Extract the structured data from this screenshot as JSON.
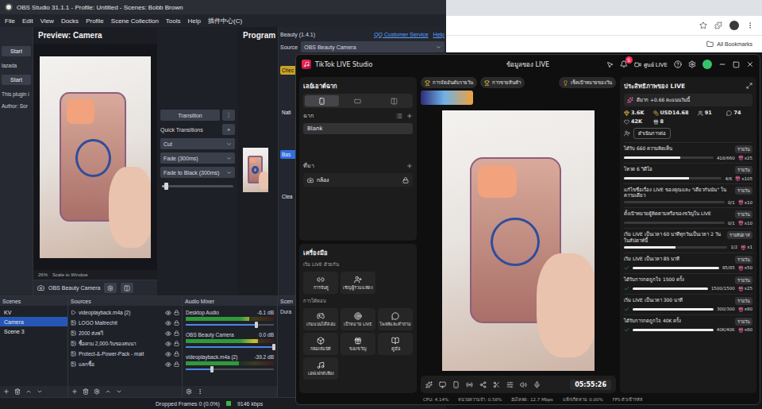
{
  "obs": {
    "title": "OBS Studio 31.1.1 - Profile: Untitled - Scenes: Bobb Brown",
    "menu": [
      "File",
      "Edit",
      "View",
      "Docks",
      "Profile",
      "Scene Collection",
      "Tools",
      "Help",
      "插件中心(C)"
    ],
    "left_dock": [
      {
        "kind": "button",
        "label": "Start"
      },
      {
        "kind": "label",
        "label": "lazada"
      },
      {
        "kind": "button",
        "label": "Start"
      },
      {
        "kind": "label",
        "label": "This plugin i"
      },
      {
        "kind": "label",
        "label": "Author: Sor"
      }
    ],
    "preview": {
      "title": "Preview: Camera",
      "zoom": "26%",
      "scale": "Scale to Window"
    },
    "program": {
      "title": "Program"
    },
    "transitions": {
      "button": "Transition",
      "menu": "⋮",
      "quick": "Quick Transitions",
      "add": "+",
      "options": [
        "Cut",
        "Fade (300ms)",
        "Fade to Black (300ms)"
      ],
      "level": 0.05
    },
    "source_bar": {
      "name": "OBS Beauty Camera"
    },
    "beauty": {
      "title": "Beauty (1.4.1)",
      "links": [
        "QQ Customer Service",
        "Help"
      ],
      "source_label": "Source",
      "source_value": "OBS Beauty Camera",
      "cut_items": [
        {
          "label": "Chec",
          "kind": "highlight"
        },
        {
          "label": "Nati",
          "kind": "label"
        },
        {
          "label": "Bas",
          "kind": "button"
        },
        {
          "label": "Clea",
          "kind": "label"
        }
      ]
    },
    "scenes": {
      "title": "Scenes",
      "items": [
        {
          "label": "KV",
          "selected": false
        },
        {
          "label": "Camera",
          "selected": true
        },
        {
          "label": "Scene 3",
          "selected": false
        }
      ]
    },
    "sources": {
      "title": "Sources",
      "items": [
        {
          "label": "videoplayback.m4a (2)",
          "kind": "audio",
          "visible": true
        },
        {
          "label": "LOGO Maitrechit",
          "kind": "image",
          "visible": true
        },
        {
          "label": "2000 ส่งฟรี",
          "kind": "image",
          "visible": true
        },
        {
          "label": "ซื้อครบ 2,000-รับของสมนา",
          "kind": "image",
          "visible": true
        },
        {
          "label": "Protect-&-Power-Pack - mait",
          "kind": "image",
          "visible": true
        },
        {
          "label": "แลกซื้อ",
          "kind": "image",
          "visible": true
        }
      ]
    },
    "mixer": {
      "title": "Audio Mixer",
      "channels": [
        {
          "name": "Desktop Audio",
          "reading": "-6.1 dB",
          "level": 0.72,
          "volume": 0.8
        },
        {
          "name": "OBS Beauty Camera",
          "reading": "0.0 dB",
          "level": 0.82,
          "volume": 1
        },
        {
          "name": "videoplayback.m4a (2)",
          "reading": "-39.2 dB",
          "level": 0.6,
          "volume": 0.3
        }
      ]
    },
    "transition_dock": {
      "title": "Scen",
      "label": "Dura"
    },
    "status": {
      "dropped": "Dropped Frames 0 (0.0%)",
      "bitrate": "9146 kbps"
    }
  },
  "browser": {
    "bookmarks": "All Bookmarks"
  },
  "tiktok": {
    "title": "TikTok LIVE Studio",
    "center_title": "ข้อมูลของ LIVE",
    "live_center": "ศูนย์ LIVE",
    "notifications": "5",
    "scene_panel": {
      "title": "เลย์เอาต์ฉาก",
      "orientations": [
        {
          "kind": "portrait",
          "selected": true
        },
        {
          "kind": "landscape",
          "selected": false
        },
        {
          "kind": "multi",
          "selected": false
        }
      ],
      "scenes_label": "ฉาก",
      "scenes": [
        {
          "label": "Blank",
          "selected": true
        }
      ],
      "sources_label": "ที่มา",
      "sources": [
        {
          "label": "กล้อง",
          "locked": true
        }
      ]
    },
    "tools": {
      "title": "เครื่องมือ",
      "groups": [
        {
          "title": "เริ่ม LIVE ด้วยกัน",
          "items": [
            "การจับคู่",
            "เชิญผู้ร่วมแสดง"
          ]
        },
        {
          "title": "การโต้ตอบ",
          "items": [
            "เกมแบบโต้ตอบ",
            "เป้าหมาย LIVE",
            "โพลล์และคำถาม",
            "กล่องสมบัติ",
            "ของขวัญ",
            "คู่มือ",
            "เอฟเฟกต์เสียง"
          ]
        }
      ]
    },
    "top_chips": [
      "การจัดอันดับรายวัน",
      "การขายสินค้า"
    ],
    "goal_chip": "เช็คเป้าหมายของวัน",
    "timer": "05:55:26",
    "status": [
      "CPU: 4.14%",
      "หน่วยความจำ: 0.58%",
      "อัปโหลด: 12.7 Mbps",
      "แพ็กเก็ตหาย: 0.00%",
      "FPS ตัวเข้ารหัส"
    ],
    "performance": {
      "title": "ประสิทธิภาพของ LIVE",
      "score": "ดีมาก +0.66 คะแนนวันนี้",
      "stats": [
        {
          "kind": "diamond",
          "value": "3.6K"
        },
        {
          "kind": "coins",
          "value": "USD14.68"
        },
        {
          "kind": "viewers",
          "value": "91"
        },
        {
          "kind": "comments",
          "value": "74"
        },
        {
          "kind": "likes",
          "value": "42K"
        },
        {
          "kind": "gifts",
          "value": "8"
        }
      ],
      "action": "ดำเนินการต่อ",
      "tasks": [
        {
          "title": "ได้รับ 660 ความคิดเห็น",
          "badge": "รายวัน",
          "progress": "418/660",
          "level": 0.633,
          "reward": "x25",
          "done": false
        },
        {
          "title": "โหวต 6 วิดีโอ",
          "badge": "รายวัน",
          "progress": "4/6",
          "level": 0.667,
          "reward": "x105",
          "done": false
        },
        {
          "title": "แก้ไขชื่อเรื่อง LIVE ของคุณและ \"เดี่ยวกันนัน\" ในความเดียว",
          "badge": "รายวัน",
          "progress": "0/1",
          "level": 0,
          "reward": "x10",
          "done": false
        },
        {
          "title": "ตั้งเป้าหมายผู้ติดตามหรือของขวัญใน LIVE",
          "badge": "รายวัน",
          "progress": "0/1",
          "level": 0,
          "reward": "x10",
          "done": false
        },
        {
          "title": "เริ่ม LIVE เป็นเวลา 60 นาทีทุกวันเป็นเวลา 2 วันในสัปดาห์นี้",
          "badge": "รายสัปดาห์",
          "progress": "1/2",
          "level": 0.5,
          "reward": "x1",
          "done": false
        },
        {
          "title": "เริ่ม LIVE เป็นเวลา 85 นาที",
          "badge": "รายวัน",
          "progress": "85/85",
          "level": 1,
          "reward": "x50",
          "done": true
        },
        {
          "title": "ได้รับการกดถูกใจ 1500 ครั้ง",
          "badge": "รายวัน",
          "progress": "1500/1500",
          "level": 1,
          "reward": "x25",
          "done": true
        },
        {
          "title": "เริ่ม LIVE เป็นเวลา 300 นาที",
          "badge": "รายวัน",
          "progress": "300/300",
          "level": 1,
          "reward": "x80",
          "done": true
        },
        {
          "title": "ได้รับการกดถูกใจ 40K ครั้ง",
          "badge": "รายวัน",
          "progress": "40K/40K",
          "level": 1,
          "reward": "x80",
          "done": true
        }
      ]
    }
  }
}
